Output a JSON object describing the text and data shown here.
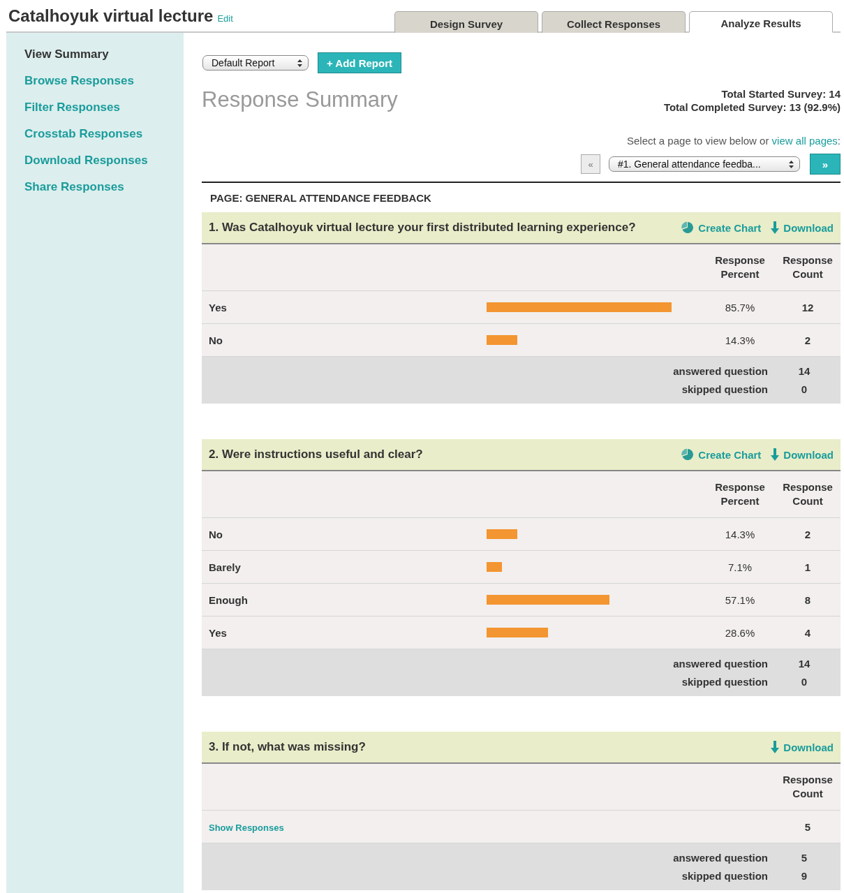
{
  "header": {
    "title": "Catalhoyuk virtual lecture",
    "edit_link": "Edit"
  },
  "tabs": [
    {
      "label": "Design Survey",
      "selected": false
    },
    {
      "label": "Collect Responses",
      "selected": false
    },
    {
      "label": "Analyze Results",
      "selected": true
    }
  ],
  "sidebar": {
    "items": [
      {
        "label": "View Summary",
        "selected": true
      },
      {
        "label": "Browse Responses",
        "selected": false
      },
      {
        "label": "Filter Responses",
        "selected": false
      },
      {
        "label": "Crosstab Responses",
        "selected": false
      },
      {
        "label": "Download Responses",
        "selected": false
      },
      {
        "label": "Share Responses",
        "selected": false
      }
    ]
  },
  "toolbar": {
    "report_select": "Default Report",
    "add_button": "+ Add Report"
  },
  "summary": {
    "title": "Response Summary",
    "stats": [
      "Total Started Survey: 14",
      "Total Completed Survey: 13  (92.9%)"
    ]
  },
  "page_nav": {
    "prompt": "Select a page to view below or",
    "link": "view all pages",
    "prompt_end": ":",
    "prev": "«",
    "select": "#1. General attendance feedba...",
    "next": "»"
  },
  "page_heading": "PAGE: GENERAL ATTENDANCE FEEDBACK",
  "questions": [
    {
      "kind": "choice",
      "title": "1. Was Catalhoyuk virtual lecture your first distributed learning experience?",
      "actions": [
        {
          "kind": "chart",
          "label": "Create Chart"
        },
        {
          "kind": "download",
          "label": "Download"
        }
      ],
      "columns": [
        "Response Percent",
        "Response Count"
      ],
      "rows": [
        {
          "label": "Yes",
          "percent": "85.7%",
          "count": "12"
        },
        {
          "label": "No",
          "percent": "14.3%",
          "count": "2"
        }
      ],
      "footer": [
        {
          "label": "answered question",
          "value": "14"
        },
        {
          "label": "skipped question",
          "value": "0"
        }
      ]
    },
    {
      "kind": "choice",
      "title": "2. Were instructions useful and clear?",
      "actions": [
        {
          "kind": "chart",
          "label": "Create Chart"
        },
        {
          "kind": "download",
          "label": "Download"
        }
      ],
      "columns": [
        "Response Percent",
        "Response Count"
      ],
      "rows": [
        {
          "label": "No",
          "percent": "14.3%",
          "count": "2"
        },
        {
          "label": "Barely",
          "percent": "7.1%",
          "count": "1"
        },
        {
          "label": "Enough",
          "percent": "57.1%",
          "count": "8"
        },
        {
          "label": "Yes",
          "percent": "28.6%",
          "count": "4"
        }
      ],
      "footer": [
        {
          "label": "answered question",
          "value": "14"
        },
        {
          "label": "skipped question",
          "value": "0"
        }
      ]
    },
    {
      "kind": "open",
      "title": "3. If not, what was missing?",
      "actions": [
        {
          "kind": "download",
          "label": "Download"
        }
      ],
      "columns": [
        "Response Count"
      ],
      "rows": [
        {
          "label": "Show Responses",
          "count": "5"
        }
      ],
      "footer": [
        {
          "label": "answered question",
          "value": "5"
        },
        {
          "label": "skipped question",
          "value": "9"
        }
      ]
    }
  ]
}
